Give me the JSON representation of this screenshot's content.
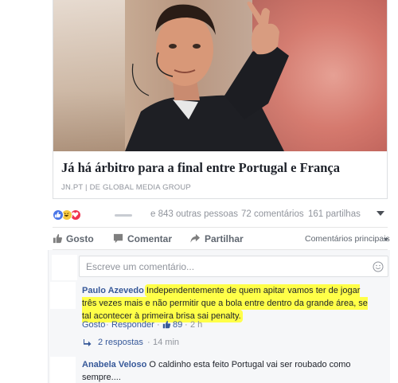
{
  "preview": {
    "title": "Já há árbitro para a final entre Portugal e França",
    "source": "JN.PT | DE GLOBAL MEDIA GROUP"
  },
  "summary": {
    "reactions": [
      "like-icon",
      "haha-icon",
      "love-icon"
    ],
    "others": "e 843 outras pessoas",
    "comments": "72 comentários",
    "shares": "161 partilhas"
  },
  "actions": {
    "like": "Gosto",
    "comment": "Comentar",
    "share": "Partilhar",
    "sort": "Comentários principais"
  },
  "composer": {
    "placeholder": "Escreve um comentário..."
  },
  "comments": [
    {
      "author": "Paulo Azevedo",
      "text": "Independentemente de quem apitar vamos ter de jogar três vezes mais e não permitir que a bola entre dentro da grande área, se tal acontecer à primeira brisa sai penalty.",
      "like": "Gosto",
      "reply": "Responder",
      "likes": "89",
      "time": "2 h",
      "replies": "2 respostas",
      "replies_time": "14 min"
    },
    {
      "author": "Anabela Veloso",
      "text": "O caldinho esta feito Portugal vai ser roubado como sempre...."
    }
  ],
  "colors": {
    "link": "#365899",
    "highlight": "#ffff48",
    "like_reaction": "#4a76e8",
    "haha_reaction": "#f7c83f",
    "love_reaction": "#f0334f"
  }
}
